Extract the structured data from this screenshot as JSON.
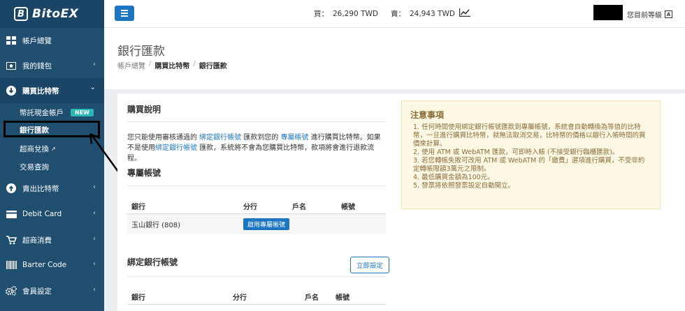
{
  "app": {
    "logo_letter": "B",
    "logo_text": "BitoEX"
  },
  "sidebar": {
    "items": [
      {
        "label": "帳戶總覽",
        "icon": "dashboard-icon"
      },
      {
        "label": "我的錢包",
        "icon": "wallet-icon",
        "chevron": "‹"
      },
      {
        "label": "購買比特幣",
        "icon": "download-icon",
        "chevron": "⌄"
      },
      {
        "label": "賣出比特幣",
        "icon": "upload-icon",
        "chevron": "‹"
      },
      {
        "label": "Debit Card",
        "icon": "card-icon",
        "chevron": "‹"
      },
      {
        "label": "超商消費",
        "icon": "cart-icon",
        "chevron": "‹"
      },
      {
        "label": "Barter Code",
        "icon": "barcode-icon",
        "chevron": "‹"
      },
      {
        "label": "會員設定",
        "icon": "gears-icon",
        "chevron": "‹"
      }
    ],
    "submenu": [
      {
        "label": "幣託現金帳戶",
        "badge": "NEW"
      },
      {
        "label": "銀行匯款"
      },
      {
        "label": "超商兌換"
      },
      {
        "label": "交易查詢"
      }
    ]
  },
  "topbar": {
    "buy_label": "買：",
    "buy_price": "26,290 TWD",
    "sell_label": "賣：",
    "sell_price": "24,943 TWD",
    "user_level": "您目前等級"
  },
  "page": {
    "title": "銀行匯款",
    "breadcrumb": [
      "帳戶總覽",
      "購買比特幣",
      "銀行匯款"
    ]
  },
  "purchase": {
    "title": "購買說明",
    "desc_1": "您只能使用審核通過的",
    "desc_link1": "綁定銀行帳號",
    "desc_2": "匯款到您的",
    "desc_link2": "專屬帳號",
    "desc_3": "進行購買比特幣。如果不是使用",
    "desc_link3": "綁定銀行帳號",
    "desc_4": "匯款，系統將不會為您購買比特幣，款項將會進行退款流程。"
  },
  "dedicated": {
    "title": "專屬帳號",
    "headers": [
      "銀行",
      "分行",
      "戶名",
      "帳號"
    ],
    "row": {
      "bank": "玉山銀行 (808)",
      "action": "啟用專屬帳號"
    }
  },
  "bound": {
    "title": "綁定銀行帳號",
    "setup_button": "立即設定",
    "headers": [
      "銀行",
      "分行",
      "戶名",
      "帳號"
    ]
  },
  "notice": {
    "title": "注意事項",
    "items": [
      "1. 任何時間使用綁定銀行帳號匯款到專屬帳號，系統會自動轉換為等值的比特幣，一旦進行購買比特幣，就無法取消交易，比特幣的價格以銀行入帳時間的買價來計算。",
      "2. 使用 ATM 或 WebATM 匯款，可即時入帳 (不接受銀行臨櫃匯款)。",
      "3. 若您轉帳失敗可改用 ATM 或 WebATM 的「繳費」選項進行購買，不受非約定轉帳限額3萬元之限制。",
      "4. 最低購買金額為100元。",
      "5. 發票將依照發票設定自動開立。"
    ]
  },
  "colors": {
    "sidebar": "#1f4e6f",
    "primary": "#1d76c2",
    "notice_bg": "#fdf8e4",
    "notice_text": "#8a6d3b",
    "badge": "#28b7b5"
  }
}
